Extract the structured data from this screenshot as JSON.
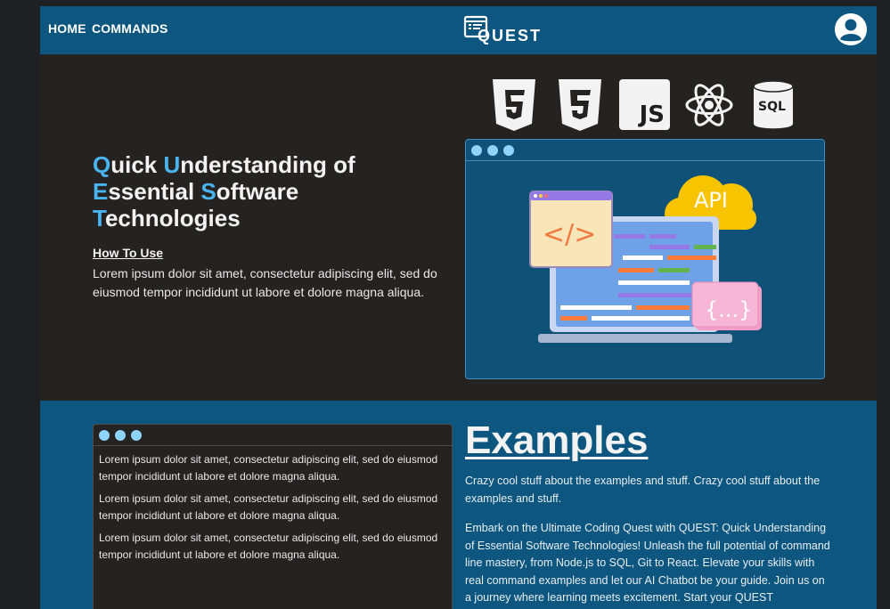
{
  "nav": {
    "home_label": "HOME",
    "commands_label": "COMMANDS",
    "logo_text": "QUEST",
    "avatar_icon": "user-circle-icon"
  },
  "hero": {
    "title_lines": [
      {
        "cap": "Q",
        "rest": "uick "
      },
      {
        "cap": "U",
        "rest": "nderstanding of"
      },
      {
        "cap": "E",
        "rest": "ssential "
      },
      {
        "cap": "S",
        "rest": "oftware"
      },
      {
        "cap": "T",
        "rest": "echnologies"
      }
    ],
    "how_to_use": "How To Use",
    "description": "Lorem ipsum dolor sit amet, consectetur adipiscing elit, sed do eiusmod tempor incididunt ut labore et dolore magna aliqua.",
    "tech_icons": [
      "html5-icon",
      "css3-icon",
      "javascript-icon",
      "react-icon",
      "sql-database-icon"
    ],
    "js_label": "JS",
    "sql_label": "SQL",
    "illustration": {
      "api_label": "API",
      "code_tag": "</>",
      "braces": "{...}"
    }
  },
  "examples": {
    "code_lines": [
      "Lorem ipsum dolor sit amet, consectetur adipiscing elit, sed do eiusmod tempor incididunt ut labore et dolore magna aliqua.",
      "Lorem ipsum dolor sit amet, consectetur adipiscing elit, sed do eiusmod tempor incididunt ut labore et dolore magna aliqua.",
      "Lorem ipsum dolor sit amet, consectetur adipiscing elit, sed do eiusmod tempor incididunt ut labore et dolore magna aliqua."
    ],
    "title": "Examples",
    "paragraph1": "Crazy cool stuff about the examples and stuff. Crazy cool stuff about the examples and stuff.",
    "paragraph2": "Embark on the Ultimate Coding Quest with QUEST: Quick Understanding of Essential Software Technologies! Unleash the full potential of command line mastery, from Node.js to SQL, Git to React. Elevate your skills with real command examples and let our AI Chatbot be your guide. Join us on a journey where learning meets excitement. Start your QUEST"
  },
  "colors": {
    "nav_bg": "#0d567f",
    "hero_bg": "#252222",
    "accent": "#49b4f0",
    "examples_bg": "#0d567f"
  }
}
